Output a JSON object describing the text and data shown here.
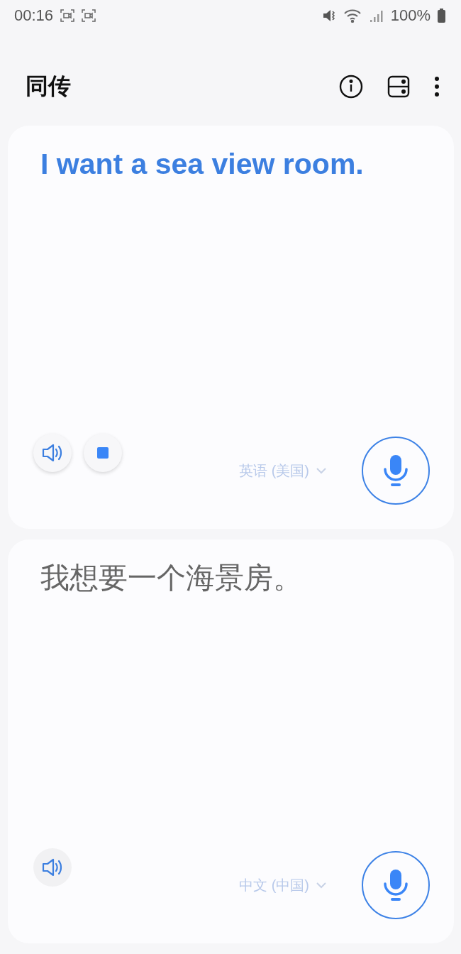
{
  "status_bar": {
    "time": "00:16",
    "battery": "100%"
  },
  "header": {
    "title": "同传"
  },
  "panels": [
    {
      "kind": "source",
      "text": "I want a sea view room.",
      "language": "英语 (美国)",
      "playing": true,
      "buttons": [
        {
          "kind": "speaker"
        },
        {
          "kind": "stop"
        }
      ]
    },
    {
      "kind": "result",
      "text": "我想要一个海景房。",
      "language": "中文 (中国)",
      "playing": false,
      "buttons": [
        {
          "kind": "speaker"
        }
      ]
    }
  ]
}
